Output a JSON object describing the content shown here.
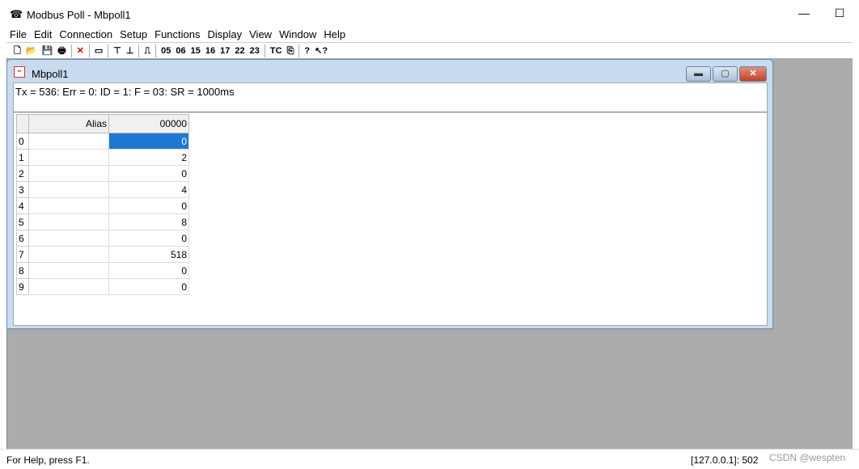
{
  "app": {
    "title": "Modbus Poll - Mbpoll1",
    "minimize": "—",
    "maximize": "☐"
  },
  "menu": [
    "File",
    "Edit",
    "Connection",
    "Setup",
    "Functions",
    "Display",
    "View",
    "Window",
    "Help"
  ],
  "toolbar": {
    "icons": [
      "new-icon",
      "open-icon",
      "save-icon",
      "print-icon",
      "delete-icon",
      "window-icon",
      "connect-icon",
      "disconnect-icon",
      "pulse-icon"
    ],
    "codes": [
      "05",
      "06",
      "15",
      "16",
      "17",
      "22",
      "23"
    ],
    "tc": "TC"
  },
  "child": {
    "title": "Mbpoll1",
    "status": "Tx = 536: Err = 0: ID = 1: F = 03: SR = 1000ms",
    "columns": [
      "Alias",
      "00000"
    ],
    "rows": [
      {
        "n": "0",
        "alias": "",
        "value": "0"
      },
      {
        "n": "1",
        "alias": "",
        "value": "2"
      },
      {
        "n": "2",
        "alias": "",
        "value": "0"
      },
      {
        "n": "3",
        "alias": "",
        "value": "4"
      },
      {
        "n": "4",
        "alias": "",
        "value": "0"
      },
      {
        "n": "5",
        "alias": "",
        "value": "8"
      },
      {
        "n": "6",
        "alias": "",
        "value": "0"
      },
      {
        "n": "7",
        "alias": "",
        "value": "518"
      },
      {
        "n": "8",
        "alias": "",
        "value": "0"
      },
      {
        "n": "9",
        "alias": "",
        "value": "0"
      }
    ]
  },
  "statusbar": {
    "help": "For Help, press F1.",
    "connection": "[127.0.0.1]: 502",
    "watermark": "CSDN @wespten"
  }
}
